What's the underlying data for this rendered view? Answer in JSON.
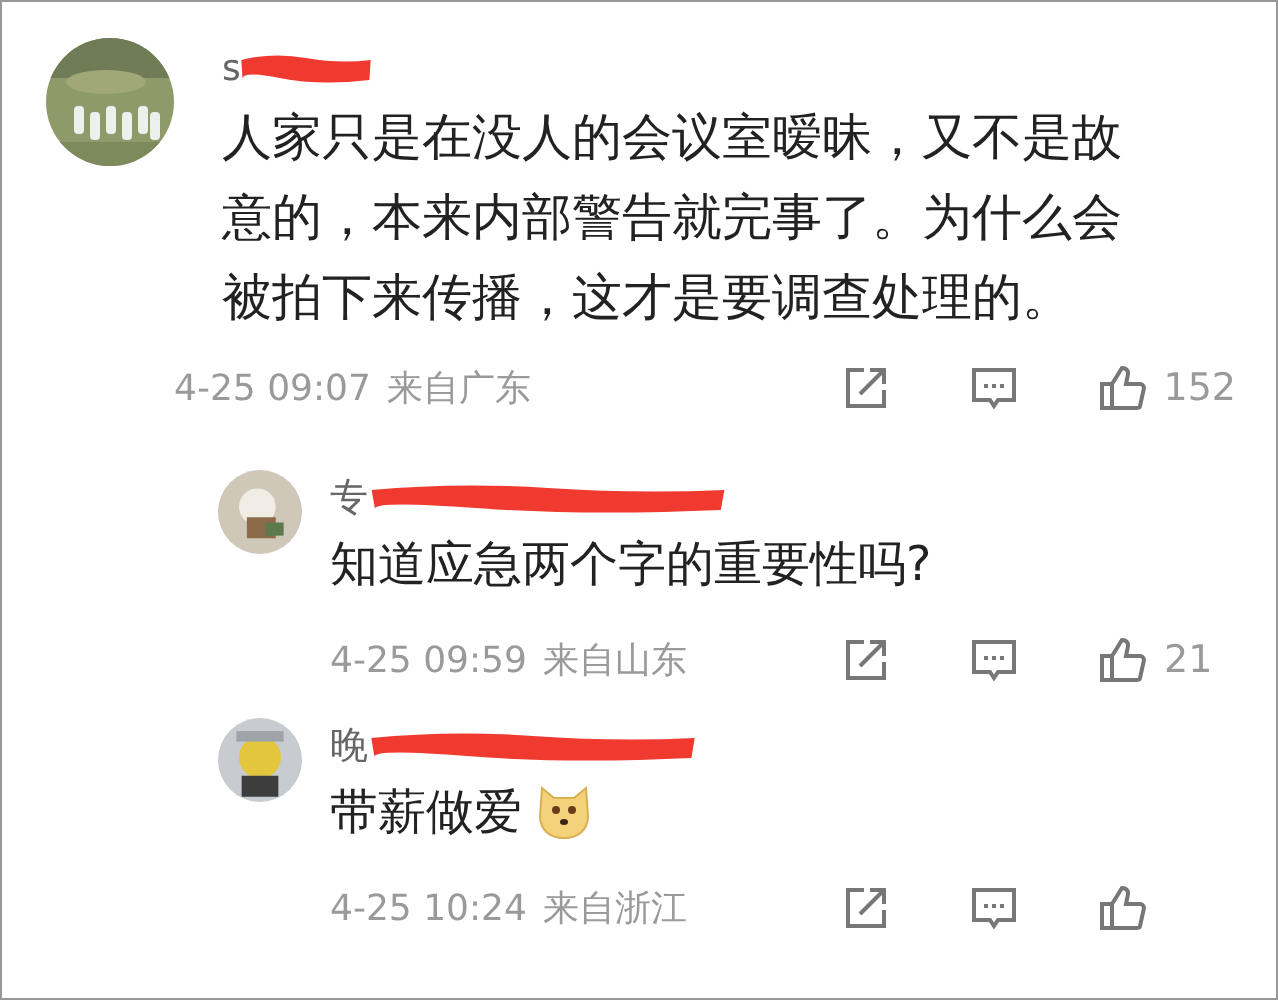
{
  "comments": [
    {
      "kind": "top",
      "name": "s",
      "redacted": true,
      "text": "人家只是在没人的会议室暧昧，又不是故意的，本来内部警告就完事了。为什么会被拍下来传播，这才是要调查处理的。",
      "has_emoji": false,
      "time": "4-25 09:07",
      "location": "来自广东",
      "likes": "152"
    },
    {
      "kind": "reply",
      "name": "专",
      "redacted": true,
      "text": "知道应急两个字的重要性吗?",
      "has_emoji": false,
      "time": "4-25 09:59",
      "location": "来自山东",
      "likes": "21"
    },
    {
      "kind": "reply",
      "name": "晚",
      "redacted": true,
      "text": "带薪做爱",
      "has_emoji": true,
      "time": "4-25 10:24",
      "location": "来自浙江"
    }
  ]
}
